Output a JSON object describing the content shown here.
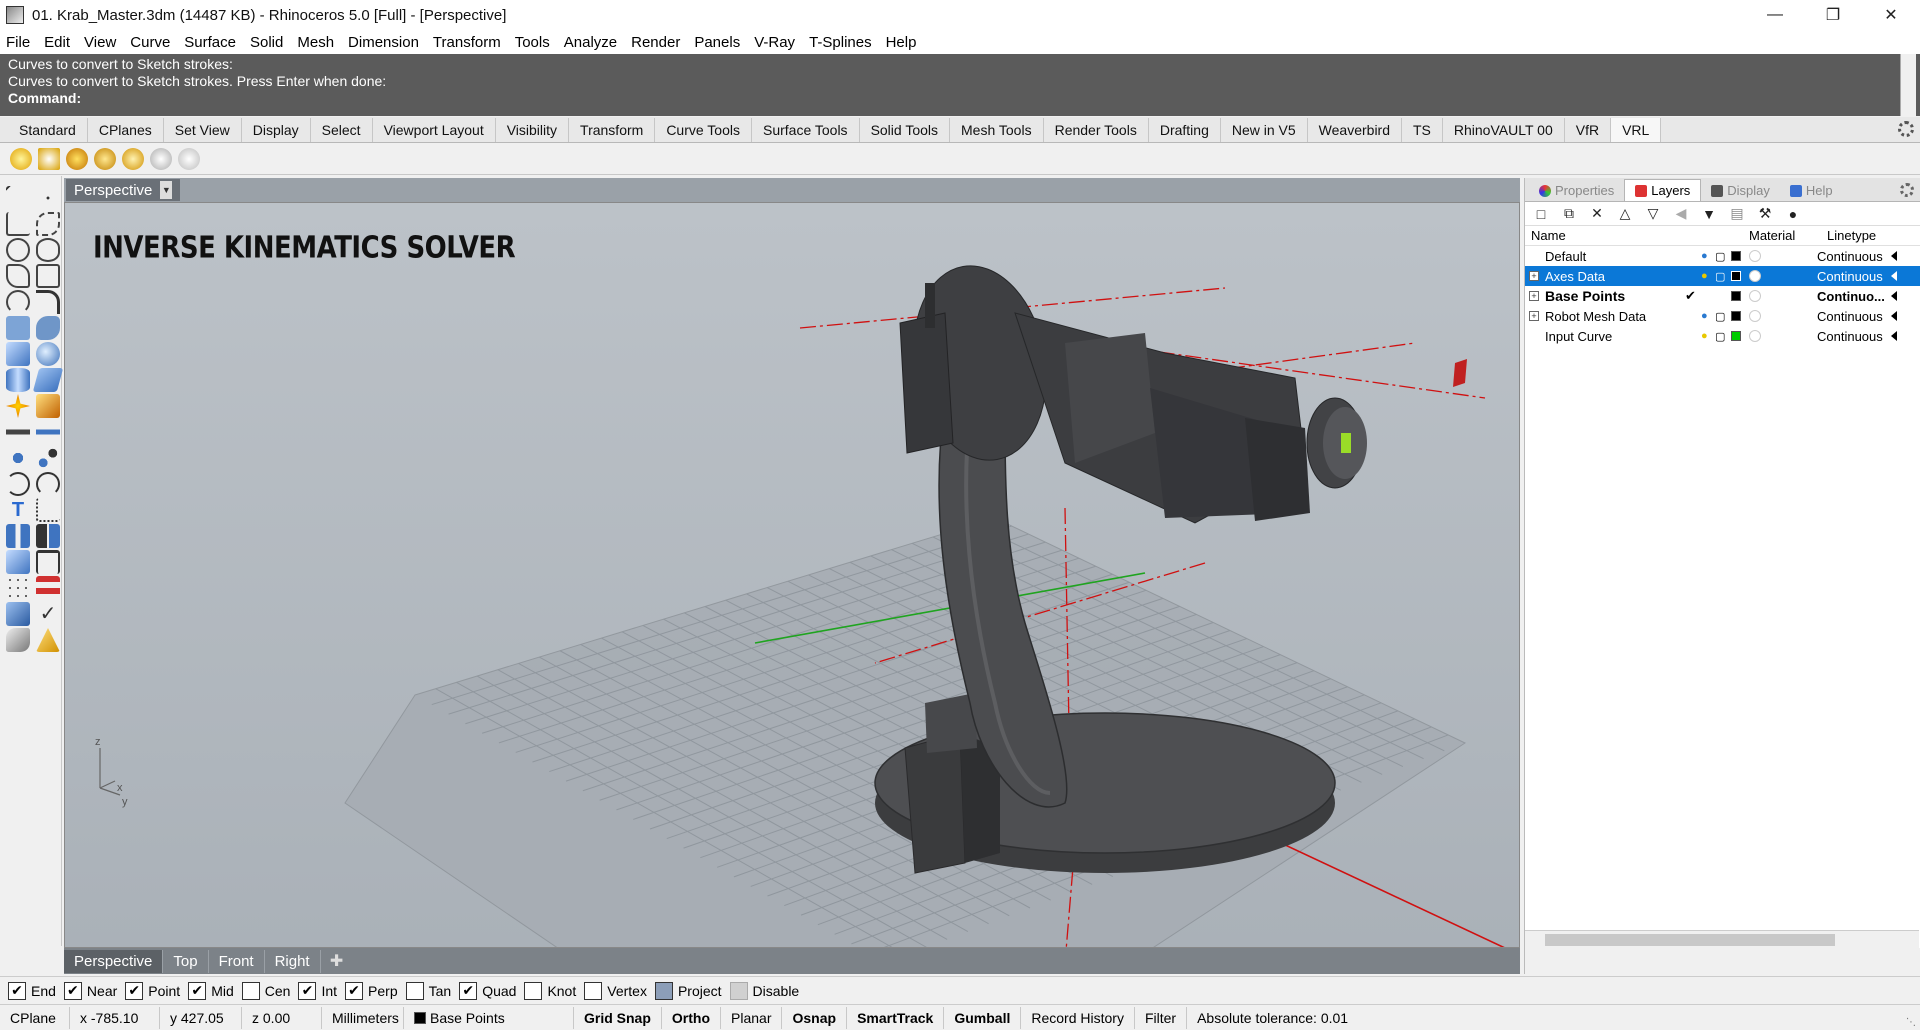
{
  "window": {
    "title": "01. Krab_Master.3dm (14487 KB) - Rhinoceros 5.0 [Full] - [Perspective]"
  },
  "menu": [
    "File",
    "Edit",
    "View",
    "Curve",
    "Surface",
    "Solid",
    "Mesh",
    "Dimension",
    "Transform",
    "Tools",
    "Analyze",
    "Render",
    "Panels",
    "V-Ray",
    "T-Splines",
    "Help"
  ],
  "command": {
    "history_1": "Curves to convert to Sketch strokes:",
    "history_2": "Curves to convert to Sketch strokes. Press Enter when done:",
    "prompt": "Command:"
  },
  "toolbar_tabs": [
    "Standard",
    "CPlanes",
    "Set View",
    "Display",
    "Select",
    "Viewport Layout",
    "Visibility",
    "Transform",
    "Curve Tools",
    "Surface Tools",
    "Solid Tools",
    "Mesh Tools",
    "Render Tools",
    "Drafting",
    "New in V5",
    "Weaverbird",
    "TS",
    "RhinoVAULT 00",
    "VfR",
    "VRL"
  ],
  "viewport": {
    "name": "Perspective",
    "overlay_title": "INVERSE KINEMATICS SOLVER",
    "tabs": [
      "Perspective",
      "Top",
      "Front",
      "Right"
    ]
  },
  "panel": {
    "tabs": [
      "Properties",
      "Layers",
      "Display",
      "Help"
    ],
    "active_tab": "Layers",
    "columns": {
      "name": "Name",
      "material": "Material",
      "linetype": "Linetype"
    },
    "layers": [
      {
        "name": "Default",
        "linetype": "Continuous",
        "color": "#000000",
        "expandable": false,
        "current": false,
        "selected": false
      },
      {
        "name": "Axes Data",
        "linetype": "Continuous",
        "color": "#000000",
        "expandable": true,
        "current": false,
        "selected": true
      },
      {
        "name": "Base Points",
        "linetype": "Continuo...",
        "color": "#000000",
        "expandable": true,
        "current": true,
        "selected": false
      },
      {
        "name": "Robot Mesh Data",
        "linetype": "Continuous",
        "color": "#000000",
        "expandable": true,
        "current": false,
        "selected": false
      },
      {
        "name": "Input Curve",
        "linetype": "Continuous",
        "color": "#00cc00",
        "expandable": false,
        "current": false,
        "selected": false
      }
    ]
  },
  "osnaps": [
    {
      "label": "End",
      "checked": true
    },
    {
      "label": "Near",
      "checked": true
    },
    {
      "label": "Point",
      "checked": true
    },
    {
      "label": "Mid",
      "checked": true
    },
    {
      "label": "Cen",
      "checked": false
    },
    {
      "label": "Int",
      "checked": true
    },
    {
      "label": "Perp",
      "checked": true
    },
    {
      "label": "Tan",
      "checked": false
    },
    {
      "label": "Quad",
      "checked": true
    },
    {
      "label": "Knot",
      "checked": false
    },
    {
      "label": "Vertex",
      "checked": false
    },
    {
      "label": "Project",
      "checked": false,
      "state": "indeterminate"
    },
    {
      "label": "Disable",
      "checked": false,
      "state": "disabled"
    }
  ],
  "status": {
    "cplane": "CPlane",
    "x": "x -785.10",
    "y": "y 427.05",
    "z": "z 0.00",
    "units": "Millimeters",
    "layer": "Base Points",
    "grid_snap": "Grid Snap",
    "ortho": "Ortho",
    "planar": "Planar",
    "osnap": "Osnap",
    "smarttrack": "SmartTrack",
    "gumball": "Gumball",
    "record_history": "Record History",
    "filter": "Filter",
    "tolerance": "Absolute tolerance: 0.01"
  },
  "axis_labels": {
    "z": "z",
    "y": "y",
    "x": "x"
  },
  "colors": {
    "selection": "#0b78d7",
    "command_bg": "#5b5b5b",
    "viewport_bg": "#b4bac0",
    "axis_red": "#d01010",
    "axis_green": "#10a010"
  },
  "icons": {
    "panel_settings": "gear-icon",
    "expand": "plus-box-icon"
  }
}
